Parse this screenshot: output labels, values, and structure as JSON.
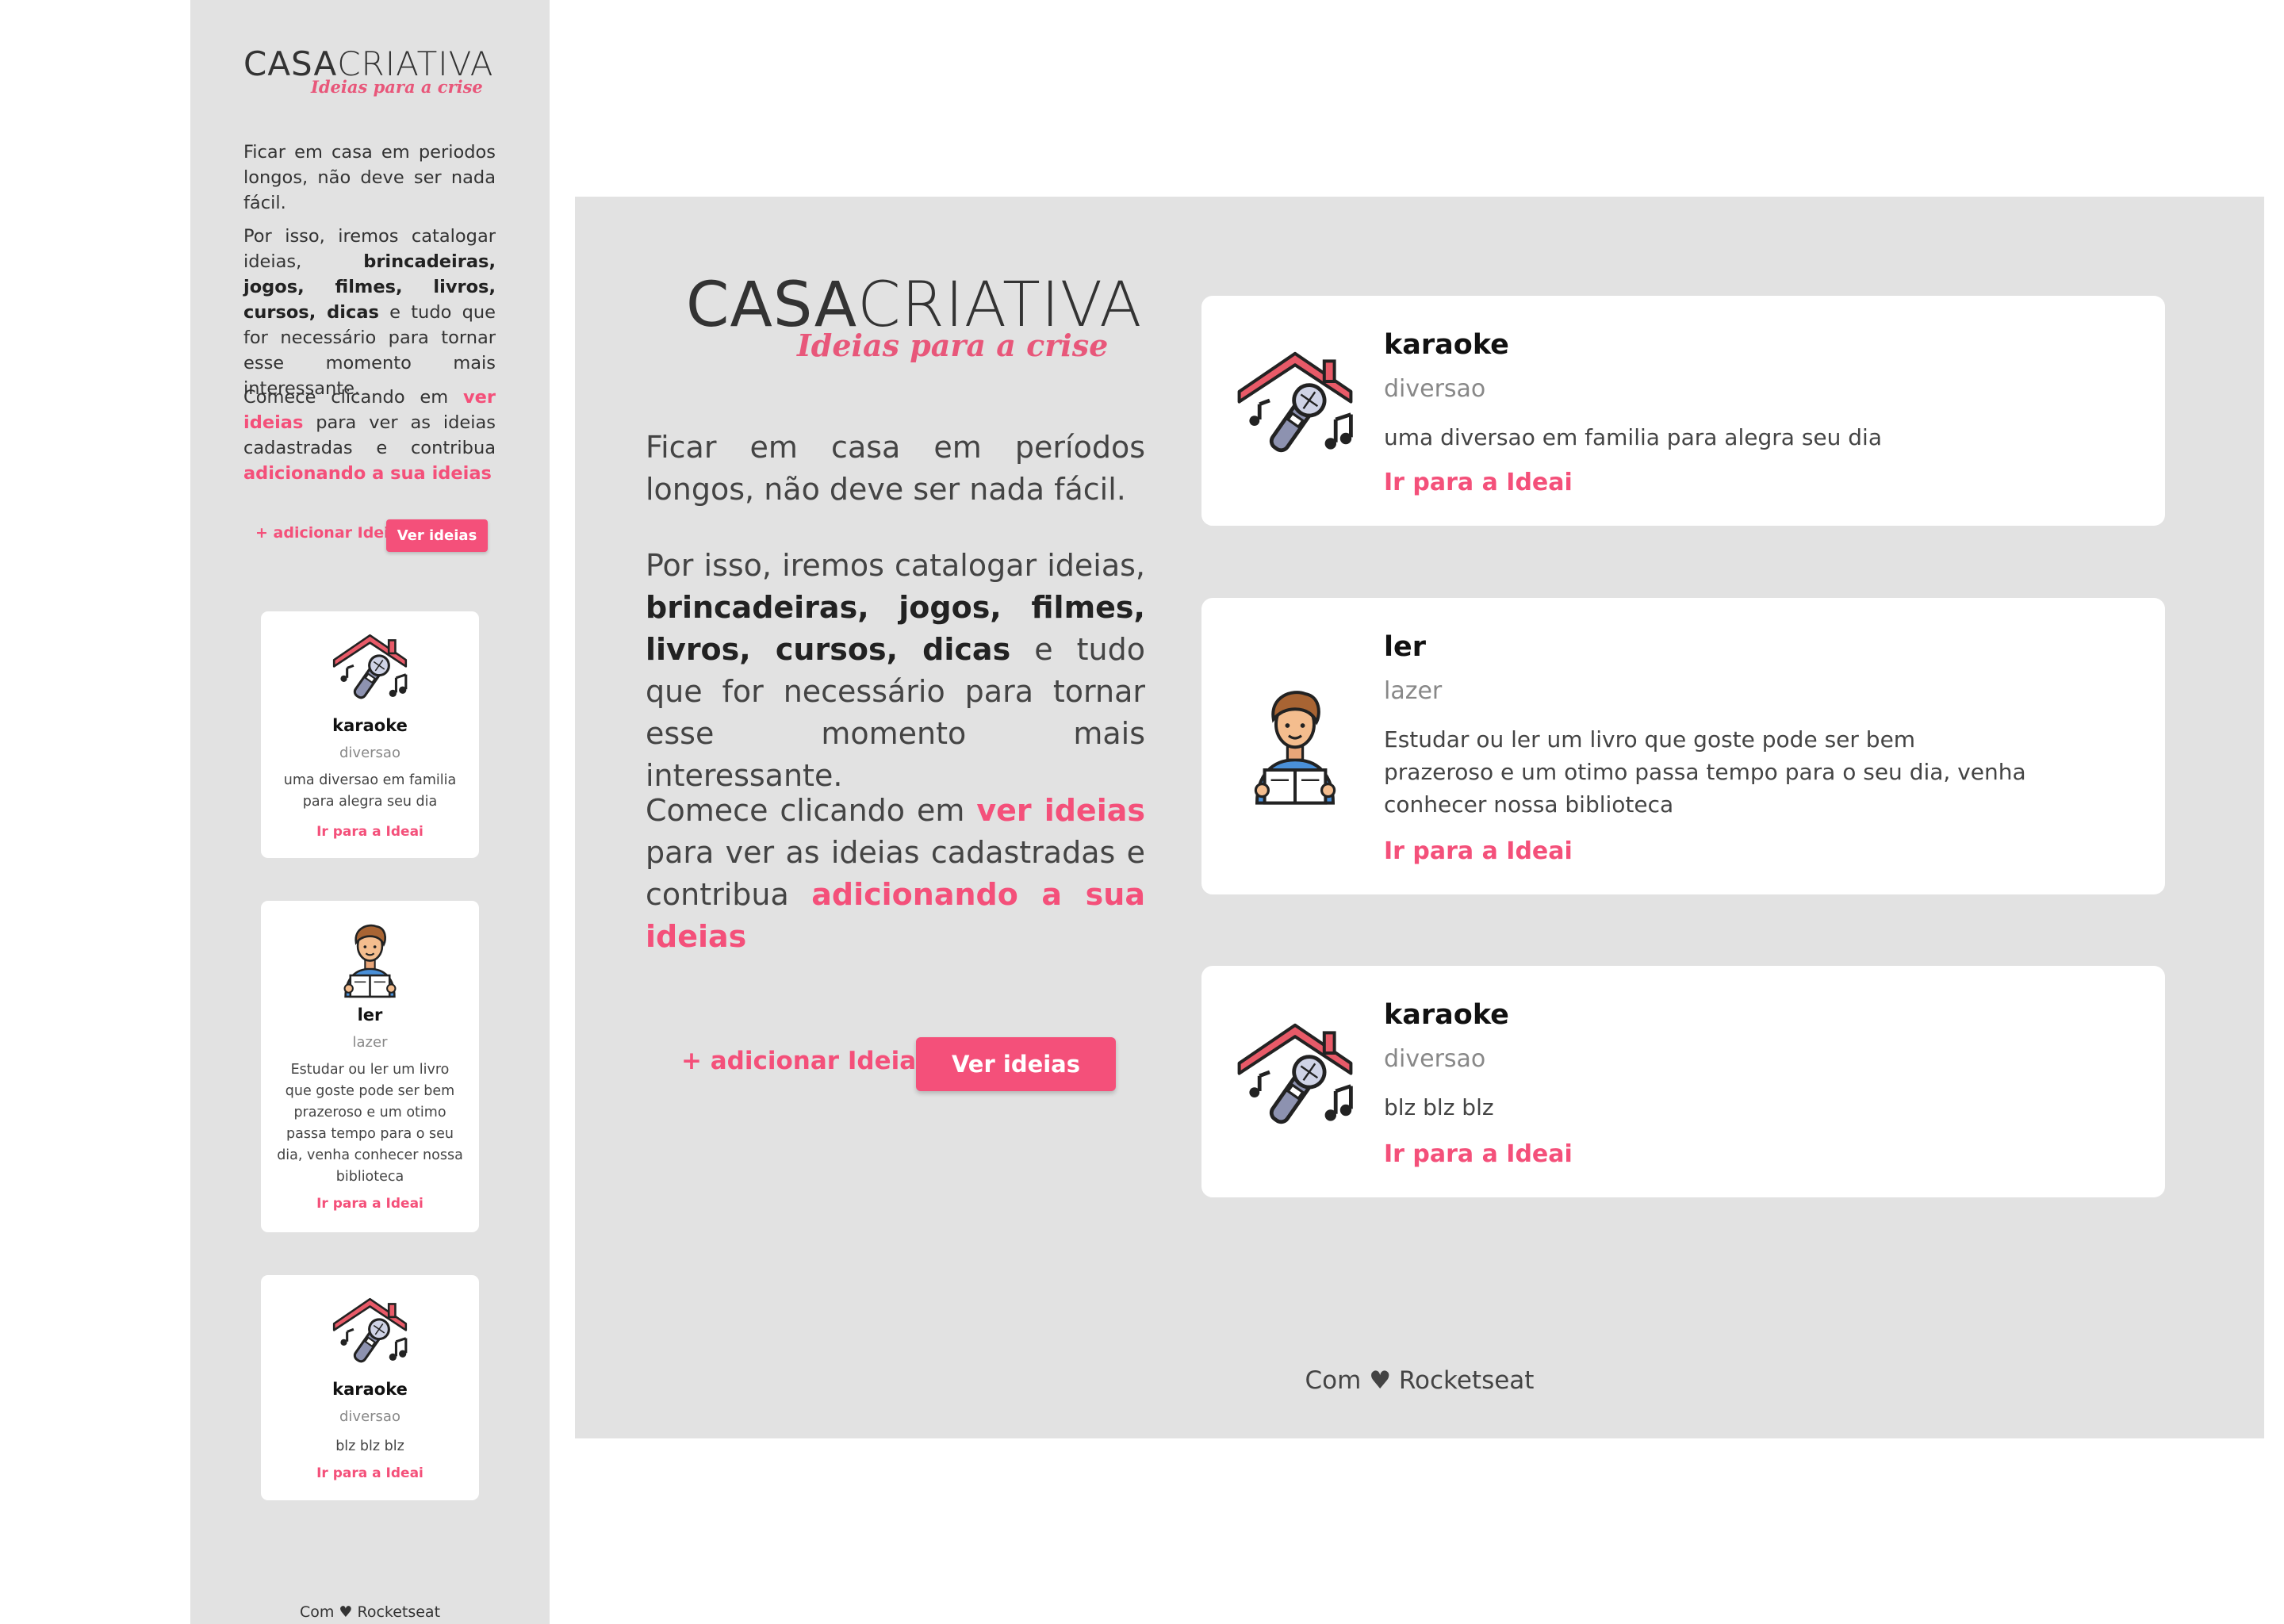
{
  "brand": {
    "name_bold": "CASA",
    "name_light": "CRIATIVA",
    "tagline": "Ideias para a crise"
  },
  "mobile": {
    "intro": {
      "p1": "Ficar em casa em periodos longos, não deve ser nada fácil.",
      "p2_pre": "Por isso, iremos catalogar ideias, ",
      "p2_bold": "brincadeiras, jogos, filmes, livros, cursos, dicas",
      "p2_post": " e tudo que for necessário para tornar esse momento mais interessante.",
      "p3_pre": "Comece clicando em ",
      "p3_link1": "ver ideias",
      "p3_mid": " para ver as ideias cadastradas e contribua ",
      "p3_link2": "adicionando a sua ideias"
    },
    "add_label": "+ adicionar Ideia",
    "view_label": "Ver ideias",
    "ideas": [
      {
        "title": "karaoke",
        "category": "diversao",
        "description": "uma diversao em familia para alegra seu dia",
        "link": "Ir para a Ideai",
        "icon": "karaoke-icon"
      },
      {
        "title": "ler",
        "category": "lazer",
        "description": "Estudar ou ler um livro que goste pode ser bem prazeroso e um otimo passa tempo para o seu dia, venha conhecer nossa biblioteca",
        "link": "Ir para a Ideai",
        "icon": "reading-icon"
      },
      {
        "title": "karaoke",
        "category": "diversao",
        "description": "blz blz blz",
        "link": "Ir para a Ideai",
        "icon": "karaoke-icon"
      }
    ],
    "footer": "Com ♥ Rocketseat"
  },
  "desktop": {
    "intro": {
      "p1": "Ficar em casa em períodos longos, não deve ser nada fácil.",
      "p2_pre": "Por isso, iremos catalogar ideias, ",
      "p2_bold": "brincadeiras, jogos, filmes, livros, cursos, dicas",
      "p2_post": " e tudo que for necessário para tornar esse momento mais interessante.",
      "p3_pre": "Comece clicando em ",
      "p3_link1": "ver ideias",
      "p3_mid": " para ver as ideias cadastradas e contribua ",
      "p3_link2": "adicionando a sua ideias"
    },
    "add_label": "+ adicionar Ideia",
    "view_label": "Ver ideias",
    "ideas": [
      {
        "title": "karaoke",
        "category": "diversao",
        "description": "uma diversao em familia para alegra seu dia",
        "link": "Ir para a Ideai",
        "icon": "karaoke-icon"
      },
      {
        "title": "ler",
        "category": "lazer",
        "description": "Estudar ou ler um livro que goste pode ser bem prazeroso e um otimo passa tempo para o seu dia, venha conhecer nossa biblioteca",
        "link": "Ir para a Ideai",
        "icon": "reading-icon"
      },
      {
        "title": "karaoke",
        "category": "diversao",
        "description": "blz blz blz",
        "link": "Ir para a Ideai",
        "icon": "karaoke-icon"
      }
    ],
    "footer": "Com ♥ Rocketseat"
  },
  "colors": {
    "accent": "#f4507a",
    "panel": "#e2e2e2",
    "card": "#ffffff",
    "roof": "#e85a68",
    "mic": "#8d92b0"
  }
}
